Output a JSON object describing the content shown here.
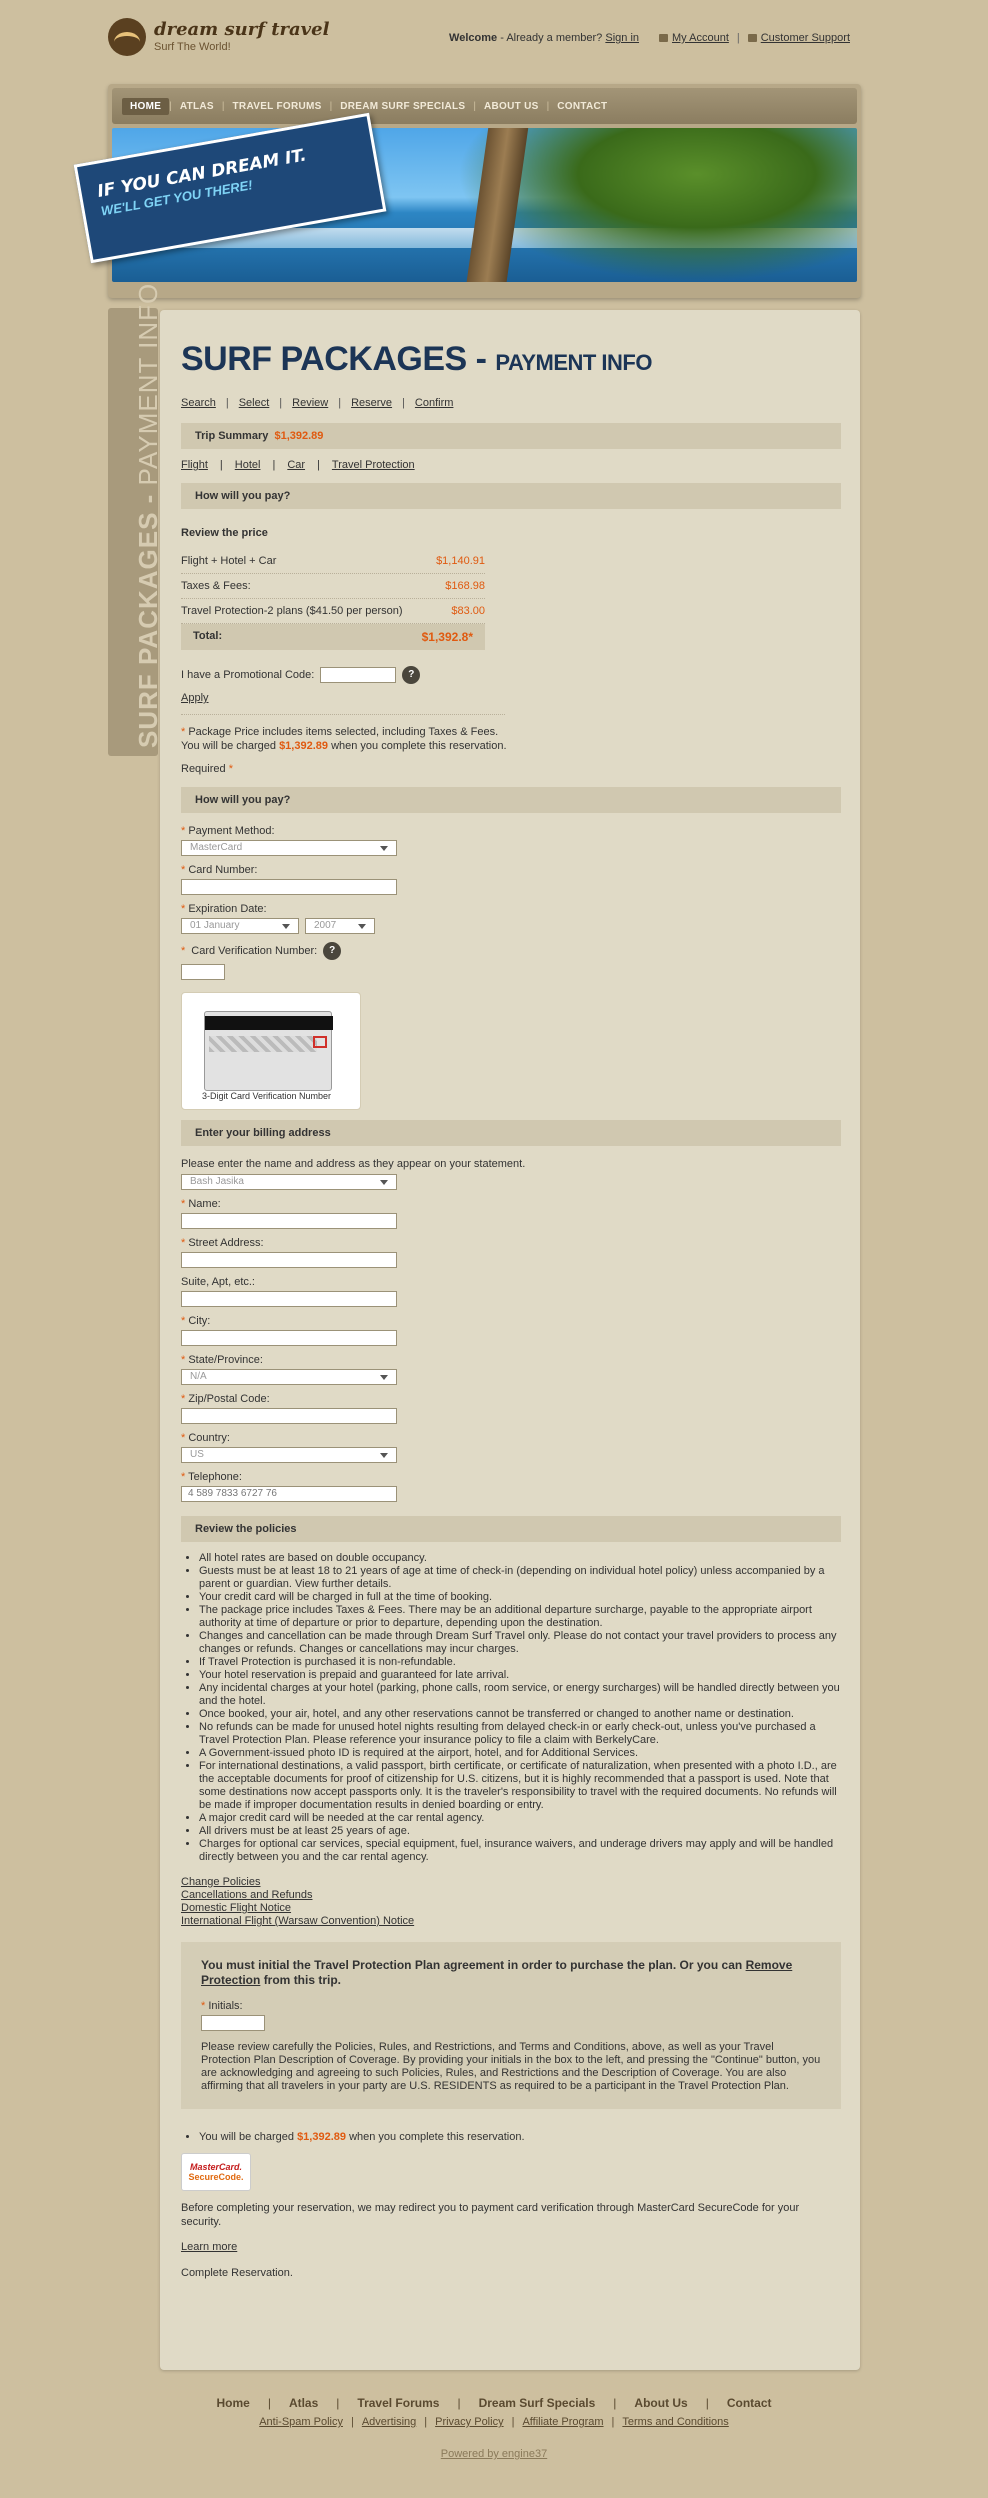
{
  "brand": {
    "name": "dream surf travel",
    "tagline": "Surf The World!"
  },
  "toplinks": {
    "welcome": "Welcome",
    "member_text": "- Already a member?",
    "signin": "Sign in",
    "account": "My Account",
    "support": "Customer Support"
  },
  "nav": [
    "HOME",
    "ATLAS",
    "TRAVEL FORUMS",
    "DREAM SURF SPECIALS",
    "ABOUT US",
    "CONTACT"
  ],
  "banner": {
    "line1": "IF YOU CAN DREAM IT.",
    "line2": "WE'LL GET YOU THERE!"
  },
  "sidetab": {
    "bold": "SURF PACKAGES -",
    "light": " PAYMENT INFO"
  },
  "page": {
    "title_main": "SURF PACKAGES -",
    "title_sub": "PAYMENT INFO",
    "steps": [
      "Search",
      "Select",
      "Review",
      "Reserve",
      "Confirm"
    ]
  },
  "trip_summary": {
    "label": "Trip Summary",
    "amount": "$1,392.89",
    "links": [
      "Flight",
      "Hotel",
      "Car",
      "Travel Protection"
    ]
  },
  "how_pay_head": "How will you pay?",
  "review_price": {
    "title": "Review the price",
    "rows": [
      {
        "label": "Flight + Hotel + Car",
        "value": "$1,140.91"
      },
      {
        "label": "Taxes & Fees:",
        "value": "$168.98"
      },
      {
        "label": "Travel Protection-2 plans ($41.50 per person)",
        "value": "$83.00"
      }
    ],
    "total_label": "Total:",
    "total_value": "$1,392.8*"
  },
  "promo": {
    "label": "I have a Promotional Code:",
    "help": "?",
    "apply": "Apply"
  },
  "notes": {
    "line1": "Package Price includes items selected, including Taxes & Fees.",
    "line2a": "You will be charged",
    "line2_amount": "$1,392.89",
    "line2b": "when you complete this reservation.",
    "required": "Required"
  },
  "payment": {
    "head": "How will you pay?",
    "method_label": "Payment Method:",
    "method_value": "MasterCard",
    "card_label": "Card Number:",
    "exp_label": "Expiration Date:",
    "exp_month": "01 January",
    "exp_year": "2007",
    "cvv_label": "Card Verification Number:",
    "cvv_help": "?",
    "card_caption": "3-Digit Card Verification Number"
  },
  "billing": {
    "head": "Enter your billing address",
    "intro": "Please enter the name and address as they appear on your statement.",
    "saved_name": "Bash Jasika",
    "name_label": "Name:",
    "street_label": "Street Address:",
    "suite_label": "Suite, Apt, etc.:",
    "city_label": "City:",
    "state_label": "State/Province:",
    "state_value": "N/A",
    "zip_label": "Zip/Postal Code:",
    "country_label": "Country:",
    "country_value": "US",
    "phone_label": "Telephone:",
    "phone_value": "4 589 7833 6727 76"
  },
  "policies": {
    "head": "Review the policies",
    "items": [
      "All hotel rates are based on double occupancy.",
      "Guests must be at least 18 to 21 years of age at time of check-in (depending on individual hotel policy) unless accompanied by a parent or guardian. View further details.",
      "Your credit card will be charged in full at the time of booking.",
      "The package price includes Taxes & Fees. There may be an additional departure surcharge, payable to the appropriate airport authority at time of departure or prior to departure, depending upon the destination.",
      "Changes and cancellation can be made through Dream Surf Travel only. Please do not contact your travel providers to process any changes or refunds. Changes or cancellations may incur charges.",
      "If Travel Protection is purchased it is non-refundable.",
      "Your hotel reservation is prepaid and guaranteed for late arrival.",
      "Any incidental charges at your hotel (parking, phone calls, room service, or energy surcharges) will be handled directly between you and the hotel.",
      "Once booked, your air, hotel, and any other reservations cannot be transferred or changed to another name or destination.",
      "No refunds can be made for unused hotel nights resulting from delayed check-in or early check-out, unless you've purchased a Travel Protection Plan. Please reference your insurance policy to file a claim with BerkelyCare.",
      "A Government-issued photo ID is required at the airport, hotel, and for Additional Services.",
      "For international destinations, a valid passport, birth certificate, or certificate of naturalization, when presented with a photo I.D., are the acceptable documents for proof of citizenship for U.S. citizens, but it is highly recommended that a passport is used. Note that some destinations now accept passports only. It is the traveler's responsibility to travel with the required documents. No refunds will be made if improper documentation results in denied boarding or entry.",
      "A major credit card will be needed at the car rental agency.",
      "All drivers must be at least 25 years of age.",
      "Charges for optional car services, special equipment, fuel, insurance waivers, and underage drivers may apply and will be handled directly between you and the car rental agency."
    ],
    "links": [
      "Change Policies",
      "Cancellations and Refunds",
      "Domestic Flight Notice",
      "International Flight (Warsaw Convention) Notice"
    ]
  },
  "protection": {
    "head1": "You must initial the Travel Protection Plan agreement in order to purchase the plan. Or you can",
    "head_link": "Remove Protection",
    "head2": "from this trip.",
    "initials_label": "Initials:",
    "text": "Please review carefully the Policies, Rules, and Restrictions, and Terms and Conditions, above, as well as your Travel Protection Plan Description of Coverage. By providing your initials in the box to the left, and pressing the \"Continue\" button, you are acknowledging and agreeing to such Policies, Rules, and Restrictions and the Description of Coverage. You are also affirming that all travelers in your party are U.S. RESIDENTS as required to be a participant in the Travel Protection Plan."
  },
  "final": {
    "charge_a": "You will be charged",
    "charge_amount": "$1,392.89",
    "charge_b": "when you complete this reservation.",
    "mc_line1": "MasterCard.",
    "mc_line2": "SecureCode.",
    "secure_text": "Before completing your reservation, we may redirect you to payment card verification through MasterCard SecureCode for your security.",
    "learn_more": "Learn more",
    "complete": "Complete Reservation."
  },
  "footer": {
    "nav": [
      "Home",
      "Atlas",
      "Travel Forums",
      "Dream Surf Specials",
      "About Us",
      "Contact"
    ],
    "links": [
      "Anti-Spam Policy",
      "Advertising",
      "Privacy Policy",
      "Affiliate Program",
      "Terms and Conditions"
    ],
    "powered": "Powered by engine37"
  }
}
